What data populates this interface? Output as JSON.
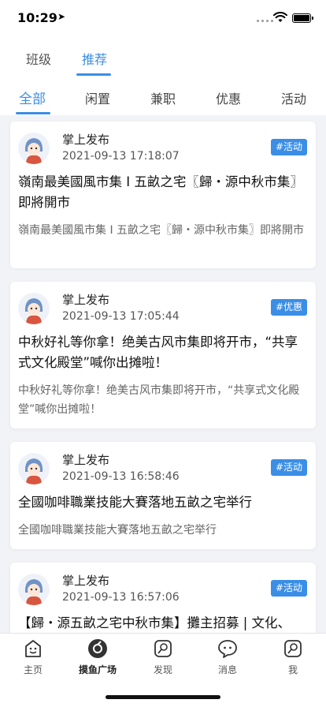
{
  "status_bar": {
    "time": "10:29"
  },
  "top_tabs": [
    {
      "label": "班级"
    },
    {
      "label": "推荐"
    }
  ],
  "category_tabs": [
    {
      "label": "全部"
    },
    {
      "label": "闲置"
    },
    {
      "label": "兼职"
    },
    {
      "label": "优惠"
    },
    {
      "label": "活动"
    }
  ],
  "posts": [
    {
      "author": "掌上发布",
      "time": "2021-09-13 17:18:07",
      "tag": "#活动",
      "title": "嶺南最美國風市集 I 五畝之宅〖歸・源中秋市集〗即將開市",
      "excerpt": "嶺南最美國風市集 I 五畝之宅〖歸・源中秋市集〗即將開市"
    },
    {
      "author": "掌上发布",
      "time": "2021-09-13 17:05:44",
      "tag": "#优惠",
      "title": "中秋好礼等你拿！绝美古风市集即将开市，“共享式文化殿堂”喊你出摊啦！",
      "excerpt": "中秋好礼等你拿！绝美古风市集即将开市，“共享式文化殿堂”喊你出摊啦！"
    },
    {
      "author": "掌上发布",
      "time": "2021-09-13 16:58:46",
      "tag": "#活动",
      "title": "全國咖啡職業技能大賽落地五畝之宅举行",
      "excerpt": "全國咖啡職業技能大賽落地五畝之宅举行"
    },
    {
      "author": "掌上发布",
      "time": "2021-09-13 16:57:06",
      "tag": "#活动",
      "title": "【歸・源五畝之宅中秋市集】攤主招募 | 文化、",
      "excerpt": ""
    }
  ],
  "tabbar": [
    {
      "label": "主页",
      "icon": "home-icon"
    },
    {
      "label": "摸鱼广场",
      "icon": "square-icon"
    },
    {
      "label": "发现",
      "icon": "discover-icon"
    },
    {
      "label": "消息",
      "icon": "message-icon"
    },
    {
      "label": "我",
      "icon": "profile-icon"
    }
  ],
  "colors": {
    "accent": "#3a8ee6",
    "background": "#f2f3f7"
  }
}
